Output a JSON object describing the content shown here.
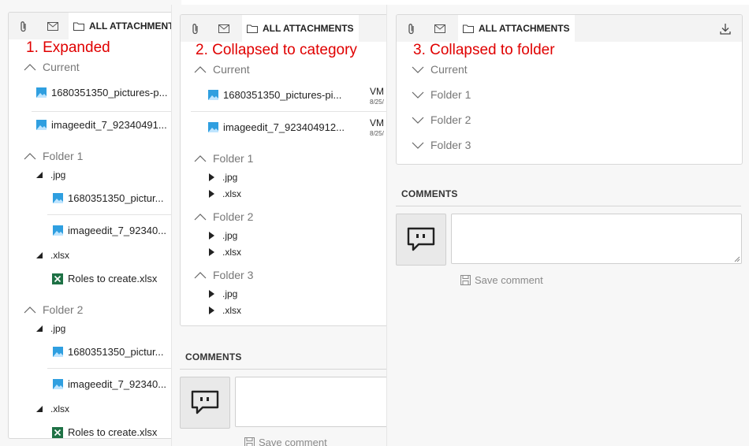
{
  "tabs": {
    "attachments_label": "ALL ATTACHMENTS"
  },
  "annotations": {
    "expanded": "1. Expanded",
    "collapsed_category": "2. Collapsed to category",
    "collapsed_folder": "3. Collapsed to folder"
  },
  "groups": {
    "current": "Current",
    "folder1": "Folder 1",
    "folder2": "Folder 2",
    "folder3": "Folder 3"
  },
  "extensions": {
    "jpg": ".jpg",
    "xlsx": ".xlsx"
  },
  "panel1": {
    "current_files": [
      "1680351350_pictures-p...",
      "imageedit_7_92340491..."
    ],
    "folder_image_1": "1680351350_pictur...",
    "folder_image_2": "imageedit_7_92340...",
    "folder_xlsx": "Roles to create.xlsx"
  },
  "panel2": {
    "current_files": [
      "1680351350_pictures-pi...",
      "imageedit_7_923404912..."
    ],
    "file_meta_initials": "VM",
    "file_meta_date": "8/25/"
  },
  "comments": {
    "heading": "COMMENTS",
    "save_label": "Save comment"
  },
  "icons": {
    "attachment": "paperclip-icon",
    "email": "envelope-icon",
    "folder": "folder-icon",
    "download": "download-icon",
    "image": "image-file-icon",
    "excel": "excel-file-icon",
    "comment": "comment-bubble-icon",
    "save": "floppy-disk-icon"
  },
  "colors": {
    "annotation": "#e00000",
    "image_icon": "#2f9fe0",
    "excel_icon": "#1e7145"
  }
}
